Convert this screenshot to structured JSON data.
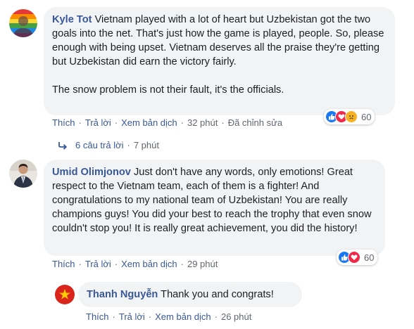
{
  "comments": [
    {
      "author": "Kyle Tot",
      "text": "Vietnam played with a lot of heart but Uzbekistan got the two goals into the net. That's just how the game is played, people. So, please enough with being upset. Vietnam deserves all the praise they're getting but Uzbekistan did earn the victory fairly.",
      "text2": "The snow problem is not their fault, it's the officials.",
      "actions": {
        "like": "Thích",
        "reply": "Trả lời",
        "translate": "Xem bản dịch",
        "time": "32 phút",
        "edited": "Đã chỉnh sửa"
      },
      "reaction_count": "60",
      "reactions": [
        "like-icon",
        "love-icon",
        "sad-icon"
      ],
      "avatar_icon": "rainbow-profile-avatar"
    },
    {
      "author": "Umid Olimjonov",
      "text": "Just don't have any words, only emotions! Great respect to the Vietnam team, each of them is a fighter! And congratulations to my national team of Uzbekistan! You are really champions guys! You did your best to reach the trophy that even snow couldn't stop you! It is really great achievement, you did the history!",
      "actions": {
        "like": "Thích",
        "reply": "Trả lời",
        "translate": "Xem bản dịch",
        "time": "29 phút"
      },
      "reaction_count": "60",
      "reactions": [
        "like-icon",
        "love-icon"
      ],
      "avatar_icon": "man-in-suit-avatar"
    }
  ],
  "replies_link": {
    "label": "6 câu trả lời",
    "time": "7 phút"
  },
  "reply": {
    "author": "Thanh Nguyễn",
    "text": "Thank you and congrats!",
    "actions": {
      "like": "Thích",
      "reply": "Trả lời",
      "translate": "Xem bản dịch",
      "time": "26 phút"
    },
    "avatar_icon": "vietnam-flag-avatar"
  },
  "colors": {
    "link": "#385898",
    "bubble": "#f2f3f5",
    "like": "#1877f2",
    "love": "#f0284a",
    "sad": "#f7b125"
  }
}
